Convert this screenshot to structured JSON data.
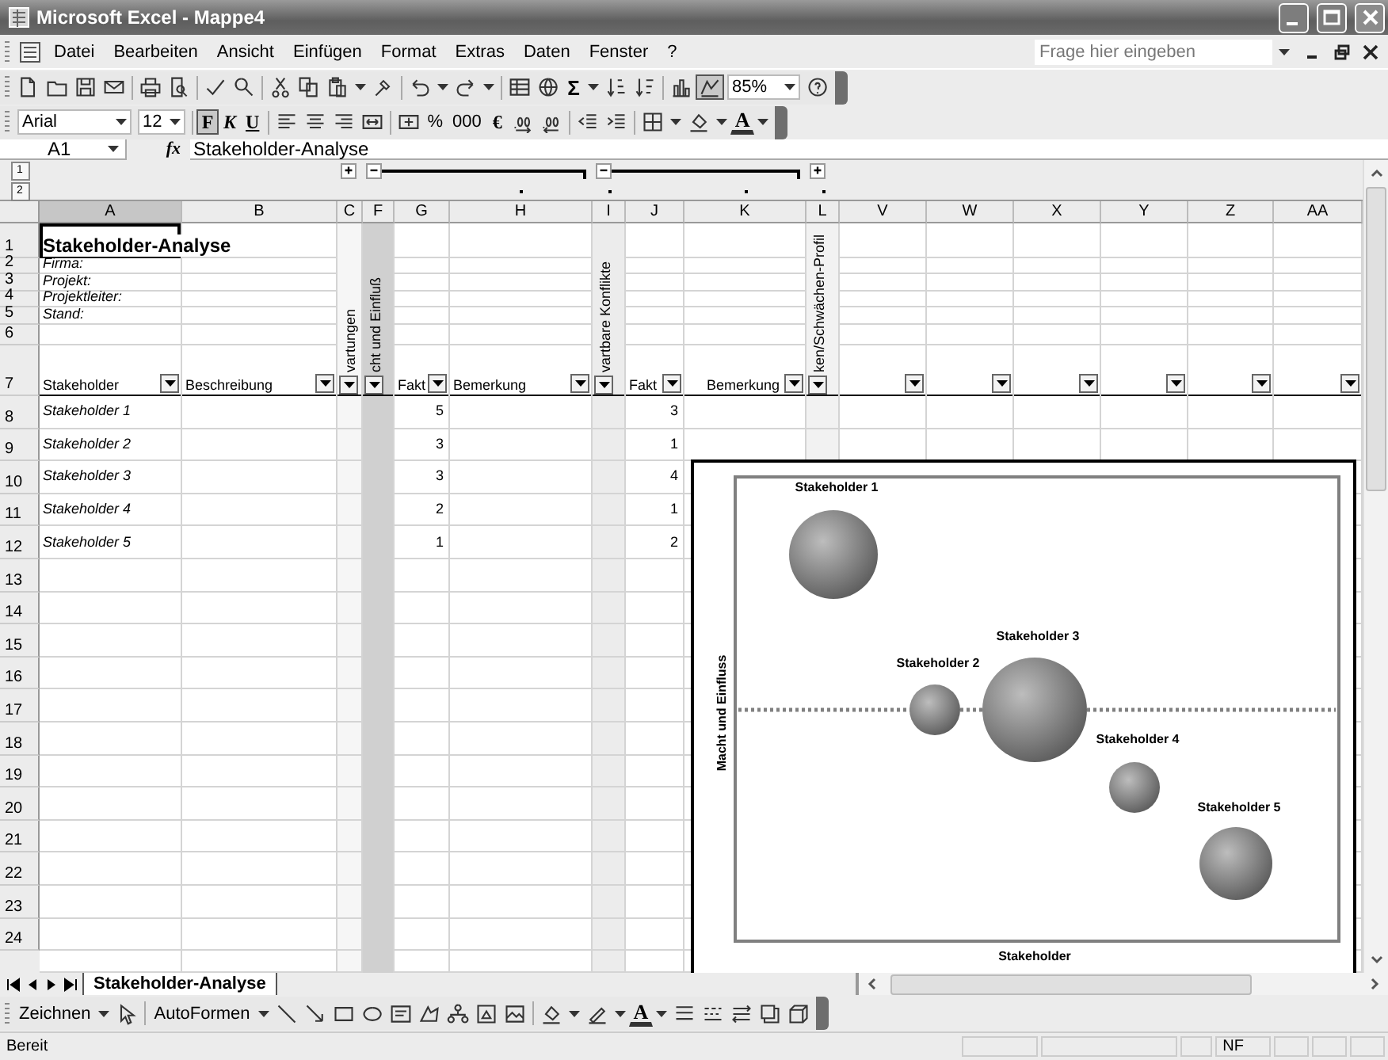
{
  "window": {
    "title": "Microsoft Excel - Mappe4"
  },
  "menu": [
    "Datei",
    "Bearbeiten",
    "Ansicht",
    "Einfügen",
    "Format",
    "Extras",
    "Daten",
    "Fenster",
    "?"
  ],
  "help_search": {
    "placeholder": "Frage hier eingeben"
  },
  "standard_toolbar": {
    "sum": "Σ",
    "drawing_pressed": true,
    "zoom": "85%"
  },
  "format_toolbar": {
    "font": "Arial",
    "size": "12",
    "bold": "F",
    "bold_pressed": true,
    "italic": "K",
    "underline": "U",
    "percent": "%",
    "thousands": "000",
    "euro": "€",
    "font_color": "A"
  },
  "formula_bar": {
    "cell": "A1",
    "fx": "fx",
    "content": "Stakeholder-Analyse"
  },
  "outline": {
    "levels": [
      "1",
      "2"
    ],
    "groups": [
      {
        "expanded": false
      },
      {
        "expanded": true
      },
      {
        "expanded": true
      },
      {
        "expanded": false
      }
    ]
  },
  "sheet": {
    "columns": [
      {
        "label": "A",
        "selected": true
      },
      {
        "label": "B",
        "selected": false
      },
      {
        "label": "C",
        "selected": false
      },
      {
        "label": "F",
        "selected": false
      },
      {
        "label": "G",
        "selected": false
      },
      {
        "label": "H",
        "selected": false
      },
      {
        "label": "I",
        "selected": false
      },
      {
        "label": "J",
        "selected": false
      },
      {
        "label": "K",
        "selected": false
      },
      {
        "label": "L",
        "selected": false
      },
      {
        "label": "V",
        "selected": false
      },
      {
        "label": "W",
        "selected": false
      },
      {
        "label": "X",
        "selected": false
      },
      {
        "label": "Y",
        "selected": false
      },
      {
        "label": "Z",
        "selected": false
      },
      {
        "label": "AA",
        "selected": false
      }
    ],
    "row_numbers": [
      "1",
      "2",
      "3",
      "4",
      "5",
      "6",
      "7",
      "8",
      "9",
      "10",
      "11",
      "12",
      "13",
      "14",
      "15",
      "16",
      "17",
      "18",
      "19",
      "20",
      "21",
      "22",
      "23",
      "24"
    ],
    "title": "Stakeholder-Analyse",
    "info_labels": [
      "Firma:",
      "Projekt:",
      "Projektleiter:",
      "Stand:"
    ],
    "vertical_headers": [
      "vartungen",
      "cht und Einfluß",
      "vartbare Konflikte",
      "ken/Schwächen-Profil"
    ],
    "table_headers": [
      "Stakeholder",
      "Beschreibung",
      "Fakt",
      "Bemerkung",
      "Fakt",
      "Bemerkung"
    ],
    "rows": [
      {
        "stakeholder": "Stakeholder 1",
        "col_g": "5",
        "col_j": "3"
      },
      {
        "stakeholder": "Stakeholder 2",
        "col_g": "3",
        "col_j": "1"
      },
      {
        "stakeholder": "Stakeholder 3",
        "col_g": "3",
        "col_j": "4"
      },
      {
        "stakeholder": "Stakeholder 4",
        "col_g": "2",
        "col_j": "1"
      },
      {
        "stakeholder": "Stakeholder 5",
        "col_g": "1",
        "col_j": "2"
      }
    ]
  },
  "chart": {
    "y_title": "Macht und Einfluss",
    "x_title": "Stakeholder",
    "bubbles": [
      {
        "label": "Stakeholder 1"
      },
      {
        "label": "Stakeholder 2"
      },
      {
        "label": "Stakeholder 3"
      },
      {
        "label": "Stakeholder 4"
      },
      {
        "label": "Stakeholder 5"
      }
    ]
  },
  "sheet_tabs": [
    {
      "label": "Stakeholder-Analyse",
      "selected": true
    }
  ],
  "drawing_toolbar": {
    "draw": "Zeichnen",
    "autoshapes": "AutoFormen",
    "font_color": "A"
  },
  "status_bar": {
    "text": "Bereit",
    "indicators": [
      "NF"
    ]
  }
}
